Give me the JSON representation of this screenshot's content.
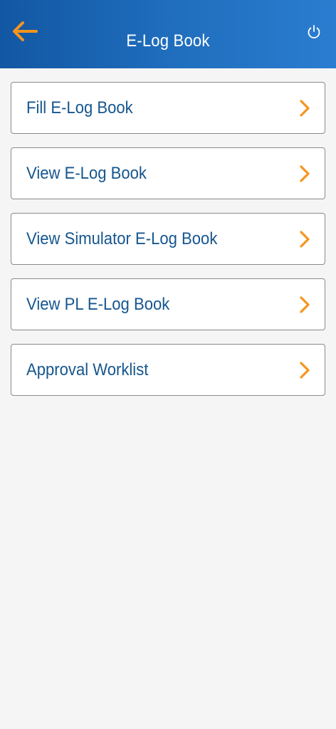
{
  "header": {
    "title": "E-Log Book",
    "back_icon": "arrow-left-icon",
    "power_icon": "power-icon",
    "accent_color": "#f7941d",
    "background_color": "#1a63b3"
  },
  "menu": {
    "items": [
      {
        "label": "Fill E-Log Book"
      },
      {
        "label": "View E-Log Book"
      },
      {
        "label": "View Simulator E-Log Book"
      },
      {
        "label": "View PL E-Log Book"
      },
      {
        "label": "Approval Worklist"
      }
    ],
    "chevron_icon": "chevron-right-icon",
    "text_color": "#16568e"
  }
}
